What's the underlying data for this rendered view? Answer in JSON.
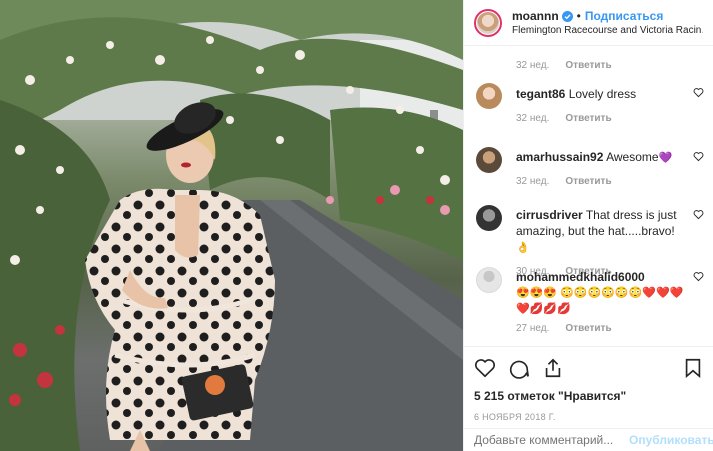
{
  "header": {
    "username": "moannn",
    "separator": "•",
    "follow_label": "Подписаться",
    "location": "Flemington Racecourse and Victoria Racing Cl..."
  },
  "comments": {
    "first_meta": {
      "time": "32 нед.",
      "reply": "Ответить"
    },
    "items": [
      {
        "user": "tegant86",
        "text": "Lovely dress",
        "emoji": "",
        "time": "32 нед.",
        "reply": "Ответить"
      },
      {
        "user": "amarhussain92",
        "text": "Awesome",
        "emoji": "💜",
        "time": "32 нед.",
        "reply": "Ответить"
      },
      {
        "user": "cirrusdriver",
        "text": "That dress is just amazing, but the hat.....bravo!",
        "emoji": "👌",
        "time": "30 нед.",
        "reply": "Ответить"
      },
      {
        "user": "mohammedkhalid6000",
        "text": "",
        "emoji": "😍😍😍 😳😳😳😳😳😳❤️❤️❤️ ❤️💋💋💋",
        "time": "27 нед.",
        "reply": "Ответить"
      }
    ]
  },
  "actions": {
    "likes": "5 215 отметок \"Нравится\"",
    "date": "6 НОЯБРЯ 2018 Г."
  },
  "add_comment": {
    "placeholder": "Добавьте комментарий...",
    "publish": "Опубликовать"
  },
  "colors": {
    "accent": "#3897f0",
    "publish_disabled": "#b2dffc",
    "muted": "#999999",
    "text": "#262626"
  },
  "icons": [
    "verified-icon",
    "heart-icon",
    "comment-icon",
    "share-icon",
    "bookmark-icon"
  ]
}
